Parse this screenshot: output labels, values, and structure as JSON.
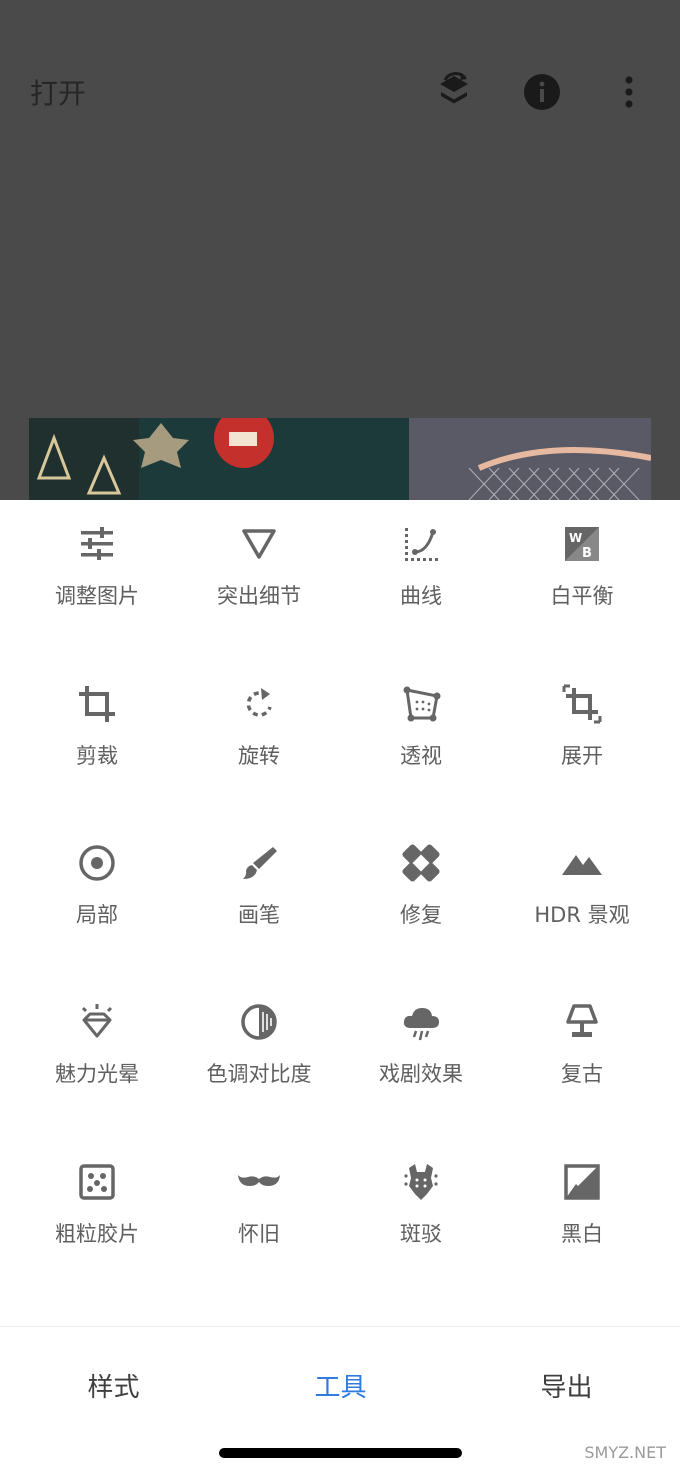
{
  "header": {
    "title": "打开",
    "icons": [
      "layers-history-icon",
      "info-icon",
      "more-vert-icon"
    ]
  },
  "tools": [
    {
      "label": "调整图片",
      "icon": "tune-icon"
    },
    {
      "label": "突出细节",
      "icon": "details-triangle-icon"
    },
    {
      "label": "曲线",
      "icon": "curves-icon"
    },
    {
      "label": "白平衡",
      "icon": "white-balance-icon"
    },
    {
      "label": "剪裁",
      "icon": "crop-icon"
    },
    {
      "label": "旋转",
      "icon": "rotate-icon"
    },
    {
      "label": "透视",
      "icon": "perspective-icon"
    },
    {
      "label": "展开",
      "icon": "expand-icon"
    },
    {
      "label": "局部",
      "icon": "selective-icon"
    },
    {
      "label": "画笔",
      "icon": "brush-icon"
    },
    {
      "label": "修复",
      "icon": "healing-icon"
    },
    {
      "label": "HDR 景观",
      "icon": "landscape-icon"
    },
    {
      "label": "魅力光晕",
      "icon": "glamour-glow-icon"
    },
    {
      "label": "色调对比度",
      "icon": "tonal-contrast-icon"
    },
    {
      "label": "戏剧效果",
      "icon": "drama-cloud-icon"
    },
    {
      "label": "复古",
      "icon": "vintage-lamp-icon"
    },
    {
      "label": "粗粒胶片",
      "icon": "grainy-film-icon"
    },
    {
      "label": "怀旧",
      "icon": "mustache-icon"
    },
    {
      "label": "斑驳",
      "icon": "grunge-guitar-icon"
    },
    {
      "label": "黑白",
      "icon": "black-white-icon"
    }
  ],
  "bottom_tabs": [
    {
      "label": "样式",
      "active": false
    },
    {
      "label": "工具",
      "active": true
    },
    {
      "label": "导出",
      "active": false
    }
  ],
  "colors": {
    "accent": "#2f7be0",
    "icon": "#666666",
    "label": "#5f5f5f",
    "overlay": "#4a4a4a"
  },
  "watermark": "SMYZ.NET"
}
